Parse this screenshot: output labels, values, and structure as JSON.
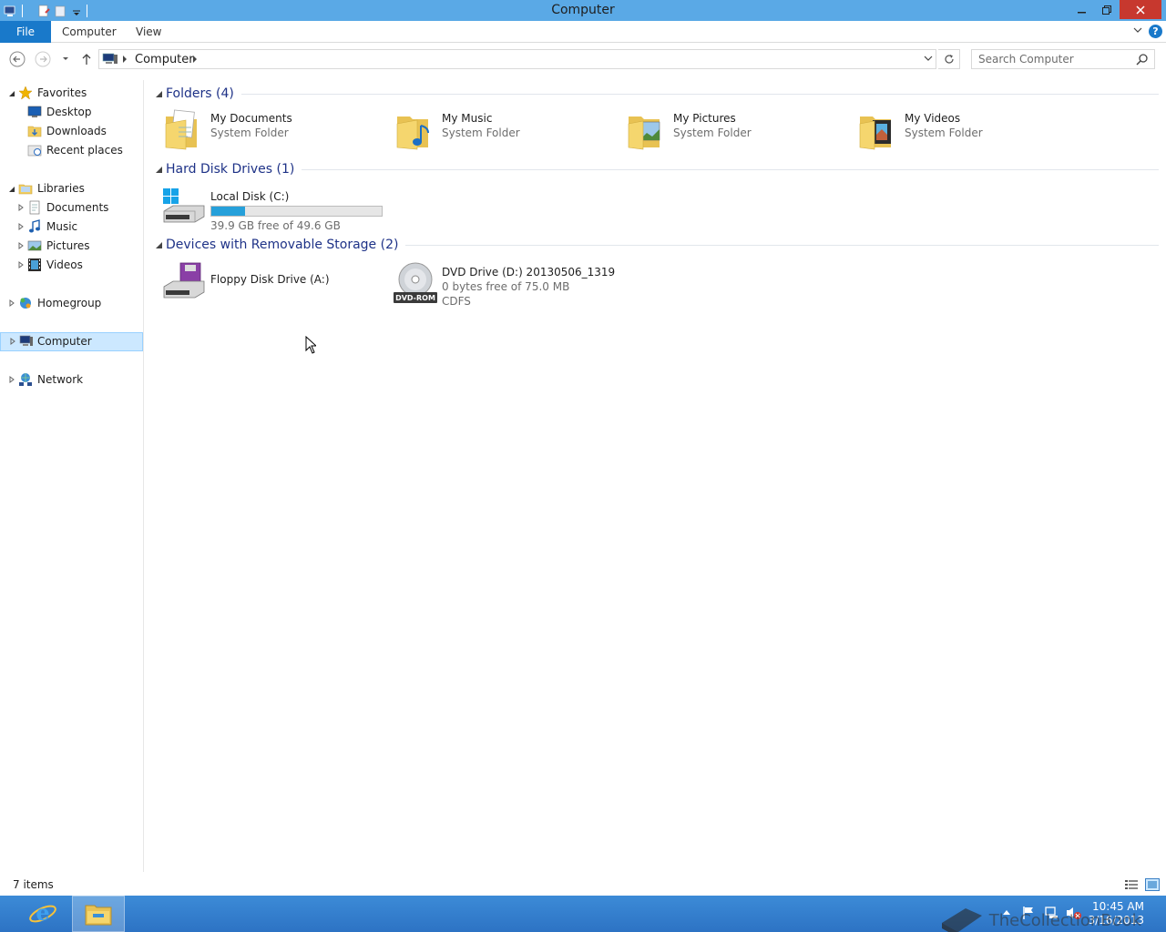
{
  "window": {
    "title": "Computer"
  },
  "ribbon": {
    "tabs": [
      "File",
      "Computer",
      "View"
    ]
  },
  "address": {
    "crumb": "Computer",
    "search_placeholder": "Search Computer"
  },
  "navpane": {
    "favorites": {
      "label": "Favorites",
      "items": [
        "Desktop",
        "Downloads",
        "Recent places"
      ]
    },
    "libraries": {
      "label": "Libraries",
      "items": [
        "Documents",
        "Music",
        "Pictures",
        "Videos"
      ]
    },
    "homegroup": "Homegroup",
    "computer": "Computer",
    "network": "Network"
  },
  "content": {
    "folders": {
      "header": "Folders (4)",
      "items": [
        {
          "name": "My Documents",
          "sub": "System Folder",
          "icon": "documents-folder-icon"
        },
        {
          "name": "My Music",
          "sub": "System Folder",
          "icon": "music-folder-icon"
        },
        {
          "name": "My Pictures",
          "sub": "System Folder",
          "icon": "pictures-folder-icon"
        },
        {
          "name": "My Videos",
          "sub": "System Folder",
          "icon": "videos-folder-icon"
        }
      ]
    },
    "hdd": {
      "header": "Hard Disk Drives (1)",
      "items": [
        {
          "name": "Local Disk (C:)",
          "free": "39.9 GB free of 49.6 GB",
          "used_fraction": 0.196
        }
      ]
    },
    "removable": {
      "header": "Devices with Removable Storage (2)",
      "items": [
        {
          "name": "Floppy Disk Drive (A:)"
        },
        {
          "name": "DVD Drive (D:) 20130506_1319",
          "free": "0 bytes free of 75.0 MB",
          "fs": "CDFS",
          "badge": "DVD-ROM"
        }
      ]
    }
  },
  "status": {
    "count": "7 items"
  },
  "taskbar": {
    "time": "10:45 AM",
    "date": "3/16/2013"
  },
  "watermark": "TheCollectionBook",
  "colors": {
    "titlebar": "#5aa9e6",
    "accent": "#1979ca",
    "group_header": "#1e3287",
    "capacity_fill": "#26a0da",
    "selection": "#cce8ff"
  }
}
